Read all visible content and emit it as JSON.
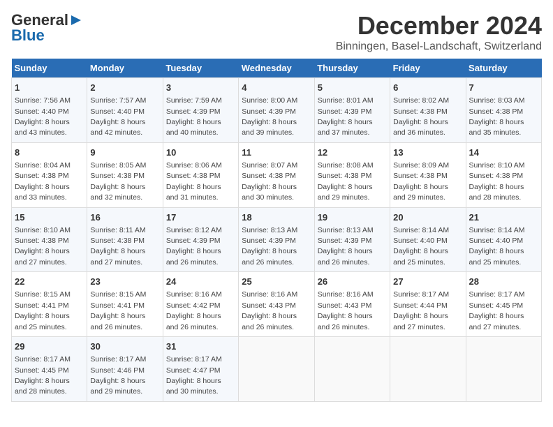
{
  "logo": {
    "line1": "General",
    "line2": "Blue"
  },
  "title": "December 2024",
  "subtitle": "Binningen, Basel-Landschaft, Switzerland",
  "days_header": [
    "Sunday",
    "Monday",
    "Tuesday",
    "Wednesday",
    "Thursday",
    "Friday",
    "Saturday"
  ],
  "weeks": [
    [
      {
        "day": "1",
        "info": "Sunrise: 7:56 AM\nSunset: 4:40 PM\nDaylight: 8 hours\nand 43 minutes."
      },
      {
        "day": "2",
        "info": "Sunrise: 7:57 AM\nSunset: 4:40 PM\nDaylight: 8 hours\nand 42 minutes."
      },
      {
        "day": "3",
        "info": "Sunrise: 7:59 AM\nSunset: 4:39 PM\nDaylight: 8 hours\nand 40 minutes."
      },
      {
        "day": "4",
        "info": "Sunrise: 8:00 AM\nSunset: 4:39 PM\nDaylight: 8 hours\nand 39 minutes."
      },
      {
        "day": "5",
        "info": "Sunrise: 8:01 AM\nSunset: 4:39 PM\nDaylight: 8 hours\nand 37 minutes."
      },
      {
        "day": "6",
        "info": "Sunrise: 8:02 AM\nSunset: 4:38 PM\nDaylight: 8 hours\nand 36 minutes."
      },
      {
        "day": "7",
        "info": "Sunrise: 8:03 AM\nSunset: 4:38 PM\nDaylight: 8 hours\nand 35 minutes."
      }
    ],
    [
      {
        "day": "8",
        "info": "Sunrise: 8:04 AM\nSunset: 4:38 PM\nDaylight: 8 hours\nand 33 minutes."
      },
      {
        "day": "9",
        "info": "Sunrise: 8:05 AM\nSunset: 4:38 PM\nDaylight: 8 hours\nand 32 minutes."
      },
      {
        "day": "10",
        "info": "Sunrise: 8:06 AM\nSunset: 4:38 PM\nDaylight: 8 hours\nand 31 minutes."
      },
      {
        "day": "11",
        "info": "Sunrise: 8:07 AM\nSunset: 4:38 PM\nDaylight: 8 hours\nand 30 minutes."
      },
      {
        "day": "12",
        "info": "Sunrise: 8:08 AM\nSunset: 4:38 PM\nDaylight: 8 hours\nand 29 minutes."
      },
      {
        "day": "13",
        "info": "Sunrise: 8:09 AM\nSunset: 4:38 PM\nDaylight: 8 hours\nand 29 minutes."
      },
      {
        "day": "14",
        "info": "Sunrise: 8:10 AM\nSunset: 4:38 PM\nDaylight: 8 hours\nand 28 minutes."
      }
    ],
    [
      {
        "day": "15",
        "info": "Sunrise: 8:10 AM\nSunset: 4:38 PM\nDaylight: 8 hours\nand 27 minutes."
      },
      {
        "day": "16",
        "info": "Sunrise: 8:11 AM\nSunset: 4:38 PM\nDaylight: 8 hours\nand 27 minutes."
      },
      {
        "day": "17",
        "info": "Sunrise: 8:12 AM\nSunset: 4:39 PM\nDaylight: 8 hours\nand 26 minutes."
      },
      {
        "day": "18",
        "info": "Sunrise: 8:13 AM\nSunset: 4:39 PM\nDaylight: 8 hours\nand 26 minutes."
      },
      {
        "day": "19",
        "info": "Sunrise: 8:13 AM\nSunset: 4:39 PM\nDaylight: 8 hours\nand 26 minutes."
      },
      {
        "day": "20",
        "info": "Sunrise: 8:14 AM\nSunset: 4:40 PM\nDaylight: 8 hours\nand 25 minutes."
      },
      {
        "day": "21",
        "info": "Sunrise: 8:14 AM\nSunset: 4:40 PM\nDaylight: 8 hours\nand 25 minutes."
      }
    ],
    [
      {
        "day": "22",
        "info": "Sunrise: 8:15 AM\nSunset: 4:41 PM\nDaylight: 8 hours\nand 25 minutes."
      },
      {
        "day": "23",
        "info": "Sunrise: 8:15 AM\nSunset: 4:41 PM\nDaylight: 8 hours\nand 26 minutes."
      },
      {
        "day": "24",
        "info": "Sunrise: 8:16 AM\nSunset: 4:42 PM\nDaylight: 8 hours\nand 26 minutes."
      },
      {
        "day": "25",
        "info": "Sunrise: 8:16 AM\nSunset: 4:43 PM\nDaylight: 8 hours\nand 26 minutes."
      },
      {
        "day": "26",
        "info": "Sunrise: 8:16 AM\nSunset: 4:43 PM\nDaylight: 8 hours\nand 26 minutes."
      },
      {
        "day": "27",
        "info": "Sunrise: 8:17 AM\nSunset: 4:44 PM\nDaylight: 8 hours\nand 27 minutes."
      },
      {
        "day": "28",
        "info": "Sunrise: 8:17 AM\nSunset: 4:45 PM\nDaylight: 8 hours\nand 27 minutes."
      }
    ],
    [
      {
        "day": "29",
        "info": "Sunrise: 8:17 AM\nSunset: 4:45 PM\nDaylight: 8 hours\nand 28 minutes."
      },
      {
        "day": "30",
        "info": "Sunrise: 8:17 AM\nSunset: 4:46 PM\nDaylight: 8 hours\nand 29 minutes."
      },
      {
        "day": "31",
        "info": "Sunrise: 8:17 AM\nSunset: 4:47 PM\nDaylight: 8 hours\nand 30 minutes."
      },
      null,
      null,
      null,
      null
    ]
  ]
}
